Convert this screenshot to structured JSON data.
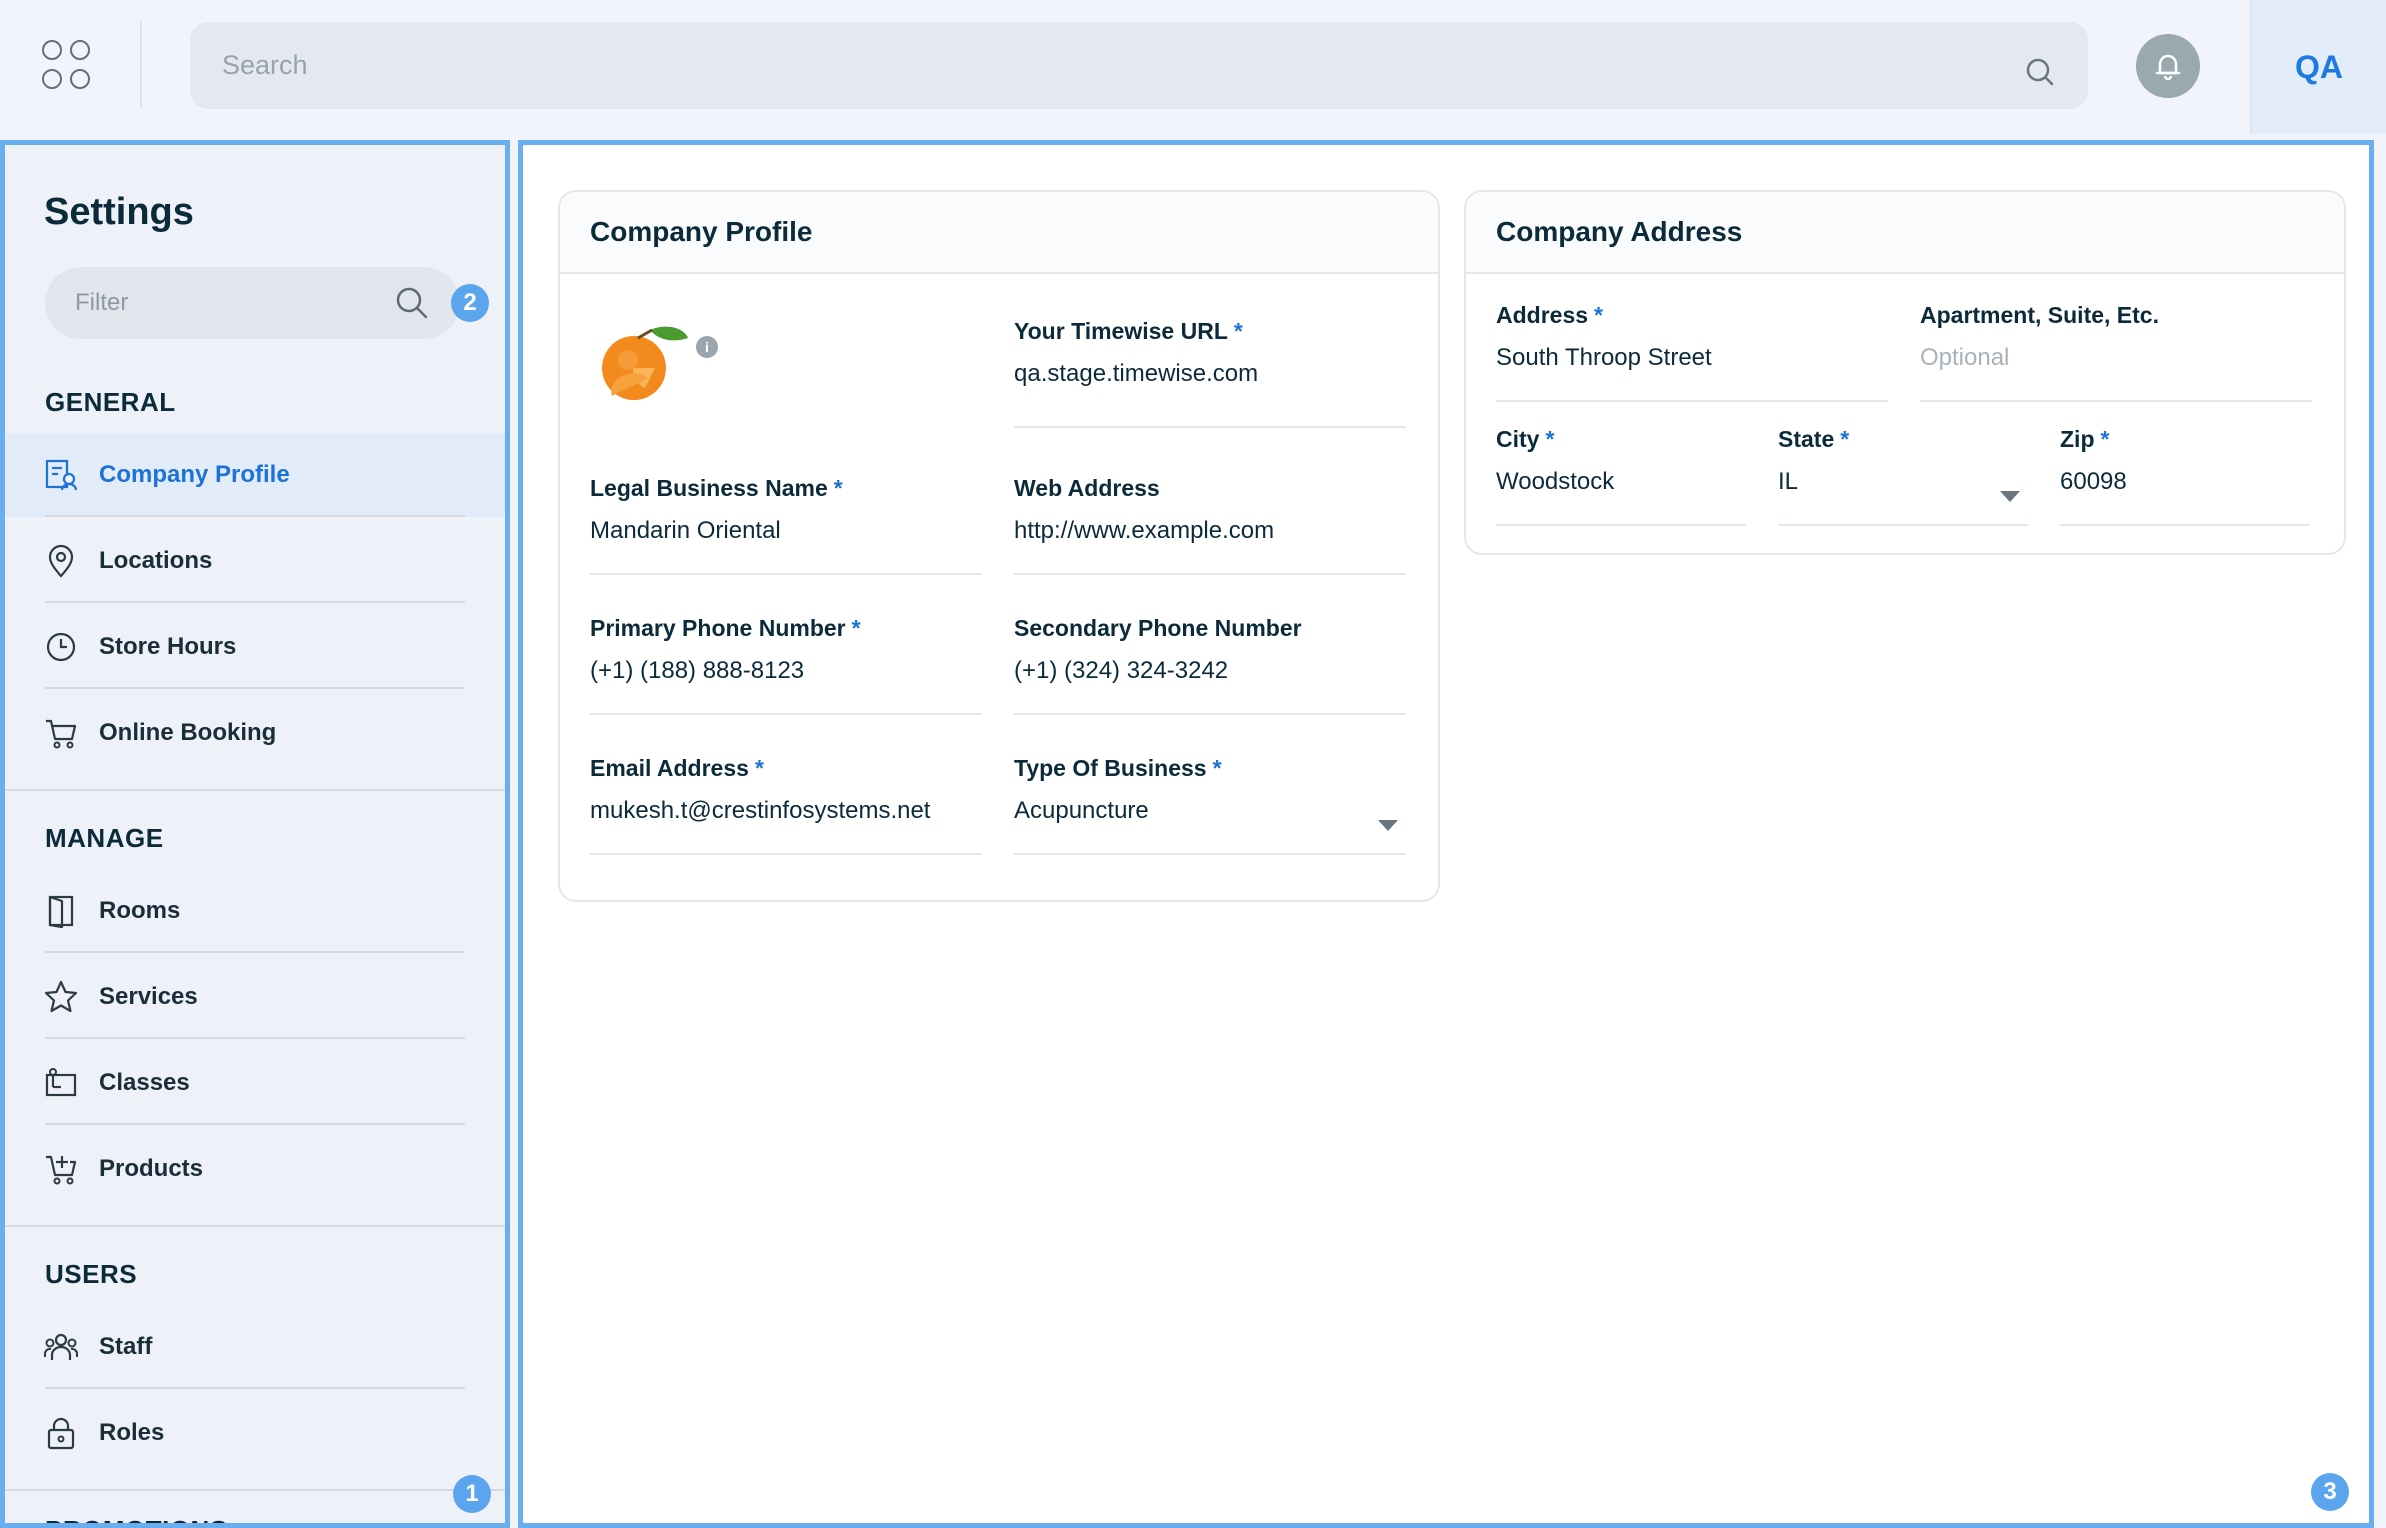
{
  "topbar": {
    "search_placeholder": "Search",
    "user_initials": "QA"
  },
  "sidebar": {
    "title": "Settings",
    "filter_placeholder": "Filter",
    "sections": [
      {
        "label": "GENERAL",
        "items": [
          {
            "label": "Company Profile",
            "icon": "company-profile-icon",
            "active": true
          },
          {
            "label": "Locations",
            "icon": "location-pin-icon"
          },
          {
            "label": "Store Hours",
            "icon": "clock-icon"
          },
          {
            "label": "Online Booking",
            "icon": "cart-icon"
          }
        ]
      },
      {
        "label": "MANAGE",
        "items": [
          {
            "label": "Rooms",
            "icon": "door-icon"
          },
          {
            "label": "Services",
            "icon": "star-icon"
          },
          {
            "label": "Classes",
            "icon": "classes-icon"
          },
          {
            "label": "Products",
            "icon": "cart-plus-icon"
          }
        ]
      },
      {
        "label": "USERS",
        "items": [
          {
            "label": "Staff",
            "icon": "staff-icon"
          },
          {
            "label": "Roles",
            "icon": "lock-icon"
          }
        ]
      },
      {
        "label": "PROMOTIONS",
        "items": []
      }
    ]
  },
  "badges": {
    "sidebar": "1",
    "filter": "2",
    "main": "3"
  },
  "company_profile": {
    "title": "Company Profile",
    "fields": {
      "timewise_url": {
        "label": "Your Timewise URL",
        "required": "*",
        "value": "qa.stage.timewise.com"
      },
      "legal_name": {
        "label": "Legal Business Name",
        "required": "*",
        "value": "Mandarin Oriental"
      },
      "web_address": {
        "label": "Web Address",
        "value": "http://www.example.com"
      },
      "primary_phone": {
        "label": "Primary Phone Number",
        "required": "*",
        "value": "(+1) (188) 888-8123"
      },
      "secondary_phone": {
        "label": "Secondary Phone Number",
        "value": "(+1) (324) 324-3242"
      },
      "email": {
        "label": "Email Address",
        "required": "*",
        "value": "mukesh.t@crestinfosystems.net"
      },
      "business_type": {
        "label": "Type Of Business",
        "required": "*",
        "value": "Acupuncture"
      }
    }
  },
  "company_address": {
    "title": "Company Address",
    "fields": {
      "address": {
        "label": "Address",
        "required": "*",
        "value": "South Throop Street"
      },
      "apartment": {
        "label": "Apartment, Suite, Etc.",
        "placeholder": "Optional"
      },
      "city": {
        "label": "City",
        "required": "*",
        "value": "Woodstock"
      },
      "state": {
        "label": "State",
        "required": "*",
        "value": "IL"
      },
      "zip": {
        "label": "Zip",
        "required": "*",
        "value": "60098"
      }
    }
  },
  "colors": {
    "accent": "#1d72d8",
    "highlight_border": "#6aaef2",
    "badge": "#5aa5ee"
  }
}
